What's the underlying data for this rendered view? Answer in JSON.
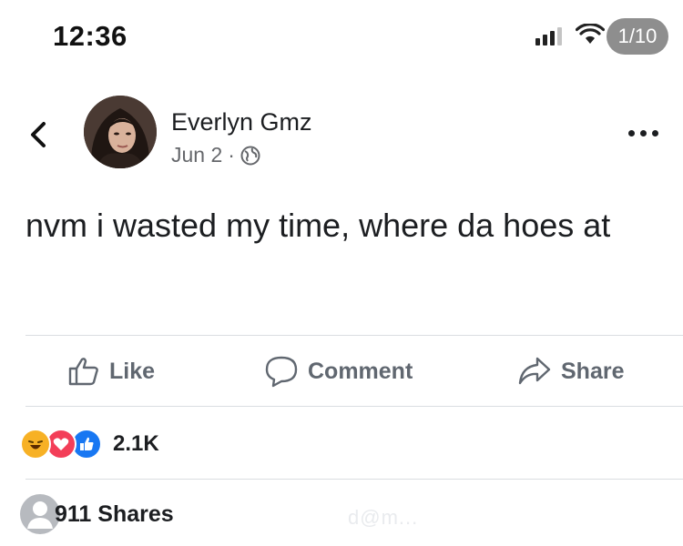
{
  "status_bar": {
    "time": "12:36",
    "page_indicator": "1/10",
    "signal_icon": "cellular-signal-icon",
    "wifi_icon": "wifi-icon"
  },
  "post": {
    "author": "Everlyn Gmz",
    "date": "Jun 2",
    "meta_separator": "·",
    "privacy_icon": "globe-icon",
    "text": "nvm i wasted my time, where da hoes at"
  },
  "actions": {
    "like_label": "Like",
    "comment_label": "Comment",
    "share_label": "Share"
  },
  "engagement": {
    "reaction_icons": [
      "haha-icon",
      "love-icon",
      "like-icon"
    ],
    "reaction_count": "2.1K",
    "shares_label": "911 Shares"
  },
  "watermark": {
    "text": "d@m..."
  },
  "colors": {
    "text": "#1c1e21",
    "secondary": "#65676b",
    "action": "#606770",
    "like_blue": "#1877f2",
    "love_red": "#f33e58",
    "haha_yellow": "#f7b125"
  }
}
